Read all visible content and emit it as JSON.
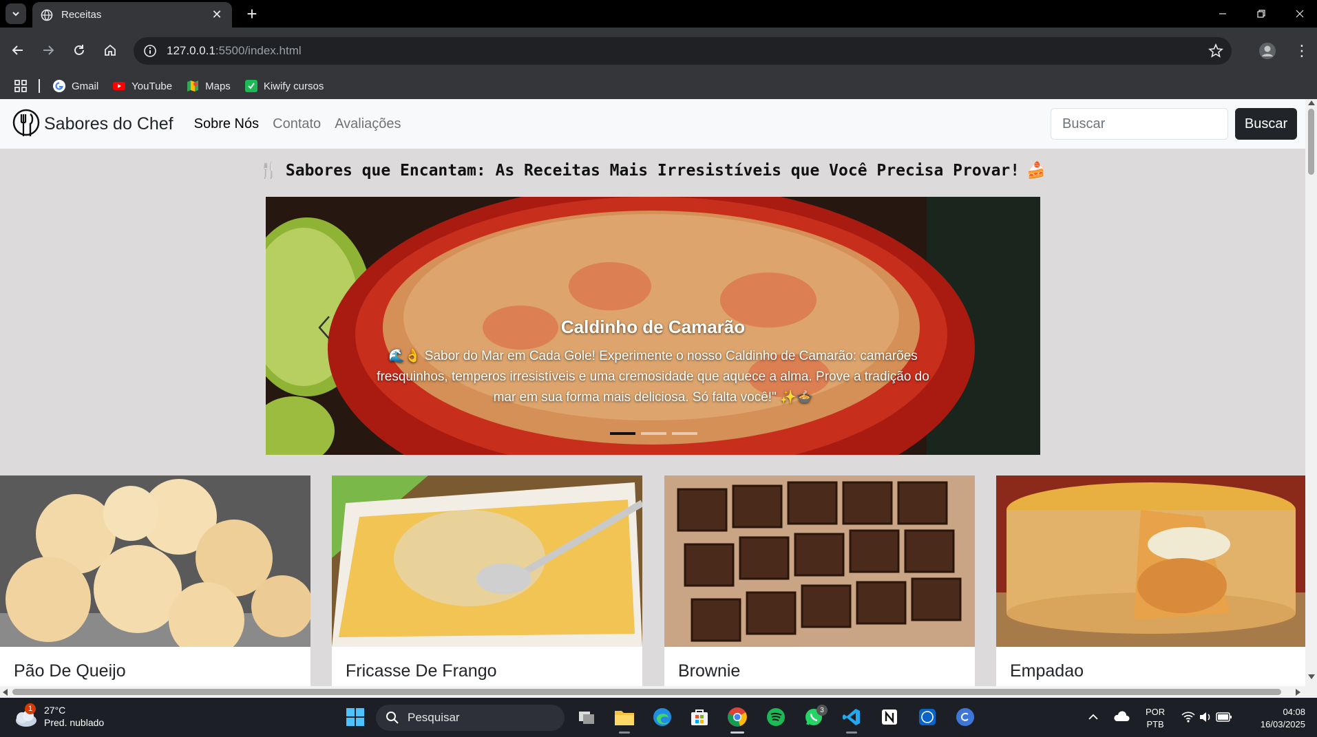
{
  "browser": {
    "tab": {
      "title": "Receitas"
    },
    "url": {
      "host": "127.0.0.1",
      "rest": ":5500/index.html"
    },
    "bookmarks": [
      {
        "label": "Gmail",
        "icon": "google-icon"
      },
      {
        "label": "YouTube",
        "icon": "youtube-icon"
      },
      {
        "label": "Maps",
        "icon": "maps-icon"
      },
      {
        "label": "Kiwify cursos",
        "icon": "kiwify-icon"
      }
    ]
  },
  "page": {
    "brand": "Sabores do Chef",
    "nav": [
      "Sobre Nós",
      "Contato",
      "Avaliações"
    ],
    "search": {
      "placeholder": "Buscar",
      "button": "Buscar"
    },
    "headline": {
      "emoji_left": "🍴",
      "text": "Sabores que Encantam: As Receitas Mais Irresistíveis que Você Precisa Provar!",
      "emoji_right": "🍰"
    },
    "carousel": {
      "title": "Caldinho de Camarão",
      "text": "🌊👌 Sabor do Mar em Cada Gole! Experimente o nosso Caldinho de Camarão: camarões fresquinhos, temperos irresistíveis e uma cremosidade que aquece a alma. Prove a tradição do mar em sua forma mais deliciosa. Só falta você!\" ✨🍲",
      "slides_count": 3,
      "active_slide": 1
    },
    "cards": [
      {
        "title": "Pão De Queijo"
      },
      {
        "title": "Fricasse De Frango"
      },
      {
        "title": "Brownie"
      },
      {
        "title": "Empadao"
      }
    ]
  },
  "taskbar": {
    "weather": {
      "temp": "27°C",
      "desc": "Pred. nublado",
      "badge": "1"
    },
    "search_placeholder": "Pesquisar",
    "whatsapp_badge": "3",
    "lang": {
      "line1": "POR",
      "line2": "PTB"
    },
    "clock": {
      "time": "04:08",
      "date": "16/03/2025"
    }
  },
  "colors": {
    "page_bg": "#dcdada",
    "navbar_bg": "#f8f9fa",
    "button_dark": "#212529",
    "chrome_bg": "#35363a"
  }
}
